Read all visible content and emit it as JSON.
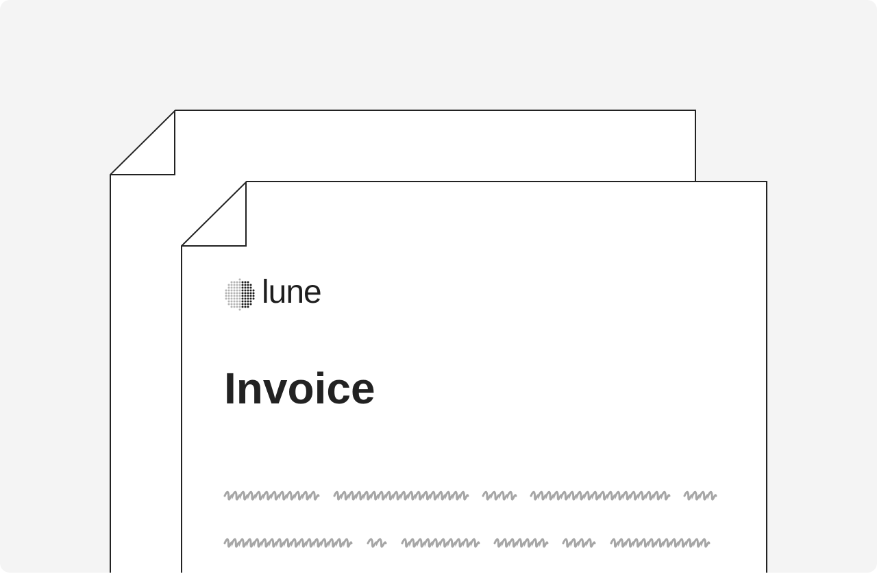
{
  "document": {
    "brand": "lune",
    "title": "Invoice"
  },
  "colors": {
    "background": "#f4f4f4",
    "page": "#ffffff",
    "outline": "#222222",
    "text": "#222222",
    "placeholder_scribble": "#a6a6a6"
  },
  "icons": {
    "logo": "lune-dotted-moon-icon"
  }
}
